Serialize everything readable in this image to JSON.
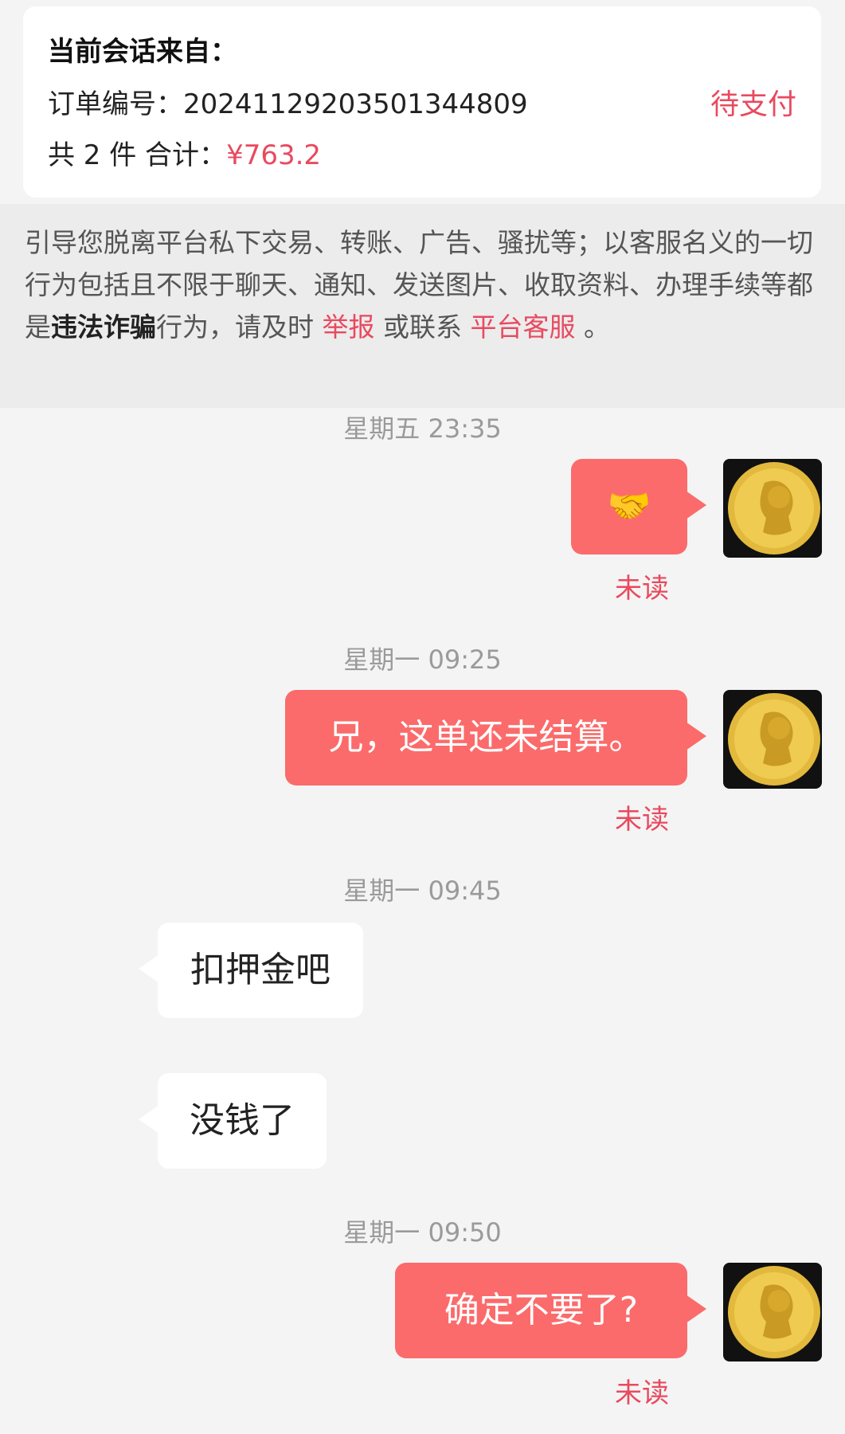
{
  "order": {
    "title": "当前会话来自：",
    "number_label": "订单编号：",
    "number": "20241129203501344809",
    "status": "待支付",
    "count_text": "共 2 件  合计：",
    "total": "¥763.2"
  },
  "notice": {
    "part1": "引导您脱离平台私下交易、转账、广告、骚扰等；以客服名义的一切行为包括且不限于聊天、通知、发送图片、收取资料、办理手续等都是",
    "bold": "违法诈骗",
    "part2": "行为，请及时 ",
    "report_link": "举报",
    "part3": " 或联系 ",
    "service_link": "平台客服",
    "part4": " 。"
  },
  "messages": [
    {
      "time": "星期五 23:35",
      "text": "🤝",
      "status": "未读"
    },
    {
      "time": "星期一 09:25",
      "text": "兄，这单还未结算。",
      "status": "未读"
    },
    {
      "time": "星期一 09:45",
      "text": "扣押金吧"
    },
    {
      "text": "没钱了"
    },
    {
      "time": "星期一 09:50",
      "text": "确定不要了?",
      "status": "未读"
    }
  ],
  "colors": {
    "accent": "#e84a5f",
    "my_bubble": "#fb6b6b",
    "avatar_gold": "#e2b93c"
  },
  "icons": {
    "avatar": "gold-coin-portrait-avatar"
  }
}
